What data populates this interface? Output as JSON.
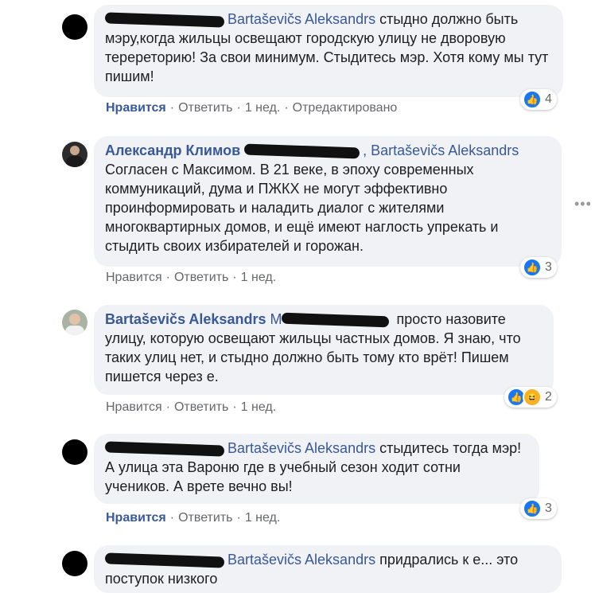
{
  "comments": [
    {
      "author_visible": "",
      "mention": "Bartaševičs Aleksandrs",
      "text": "стыдно должно быть мэру,когда жильцы освещают городскую улицу не дворовую теререторию! За свои минимум. Стыдитесь мэр. Хотя кому мы тут пишим!",
      "reaction_count": "4",
      "reactions": [
        "like"
      ],
      "like_label": "Нравится",
      "reply_label": "Ответить",
      "time": "1 нед.",
      "edited": "Отредактировано"
    },
    {
      "author_visible": "Александр Климов",
      "mention": ", Bartaševičs Aleksandrs",
      "text": "Согласен с Максимом. В 21 веке, в эпоху современных коммуникаций, дума и ПЖКХ не могут эффективно проинформировать и наладить диалог с жителями многоквартирных домов, и ещё имеют наглость упрекать и стыдить своих избирателей и горожан.",
      "reaction_count": "3",
      "reactions": [
        "like"
      ],
      "like_label": "Нравится",
      "reply_label": "Ответить",
      "time": "1 нед."
    },
    {
      "author_visible": "Bartaševičs Aleksandrs",
      "mention": "М",
      "text": "просто назовите улицу, которую освещают жильцы частных домов. Я знаю, что таких улиц нет, и стыдно должно быть тому кто врёт! Пишем пишется через е.",
      "reaction_count": "2",
      "reactions": [
        "like",
        "haha"
      ],
      "like_label": "Нравится",
      "reply_label": "Ответить",
      "time": "1 нед."
    },
    {
      "author_visible": "",
      "mention": "Bartaševičs Aleksandrs",
      "text": "стыдитесь тогда мэр! А улица эта Вароню где в учебный сезон ходит сотни учеников. А врете вечно вы!",
      "reaction_count": "3",
      "reactions": [
        "like"
      ],
      "like_label": "Нравится",
      "reply_label": "Ответить",
      "time": "1 нед."
    },
    {
      "author_visible": "",
      "mention": "Bartaševičs Aleksandrs",
      "text": "придрались к е... это поступок низкого"
    }
  ],
  "icons": {
    "like": "thumbs-up-icon",
    "haha": "laughing-face-icon",
    "more": "more-options-icon"
  },
  "more_glyph": "•••",
  "like_glyph": "👍",
  "haha_glyph": "😆",
  "colors": {
    "author": "#385898",
    "bubble": "#f0f2f5",
    "like": "#1877f2",
    "meta": "#65676b"
  }
}
